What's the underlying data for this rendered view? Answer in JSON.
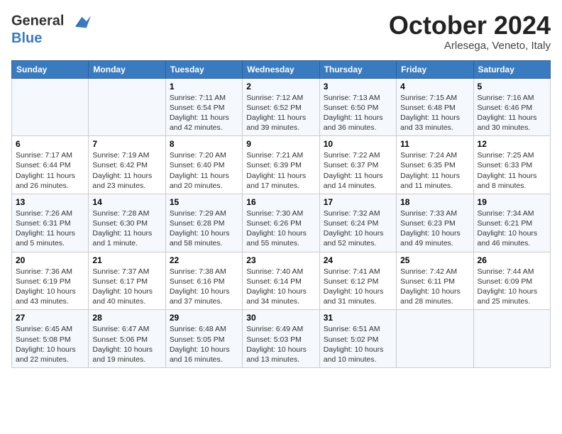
{
  "header": {
    "logo_line1": "General",
    "logo_line2": "Blue",
    "month": "October 2024",
    "location": "Arlesega, Veneto, Italy"
  },
  "weekdays": [
    "Sunday",
    "Monday",
    "Tuesday",
    "Wednesday",
    "Thursday",
    "Friday",
    "Saturday"
  ],
  "weeks": [
    [
      {
        "day": "",
        "detail": ""
      },
      {
        "day": "",
        "detail": ""
      },
      {
        "day": "1",
        "detail": "Sunrise: 7:11 AM\nSunset: 6:54 PM\nDaylight: 11 hours and 42 minutes."
      },
      {
        "day": "2",
        "detail": "Sunrise: 7:12 AM\nSunset: 6:52 PM\nDaylight: 11 hours and 39 minutes."
      },
      {
        "day": "3",
        "detail": "Sunrise: 7:13 AM\nSunset: 6:50 PM\nDaylight: 11 hours and 36 minutes."
      },
      {
        "day": "4",
        "detail": "Sunrise: 7:15 AM\nSunset: 6:48 PM\nDaylight: 11 hours and 33 minutes."
      },
      {
        "day": "5",
        "detail": "Sunrise: 7:16 AM\nSunset: 6:46 PM\nDaylight: 11 hours and 30 minutes."
      }
    ],
    [
      {
        "day": "6",
        "detail": "Sunrise: 7:17 AM\nSunset: 6:44 PM\nDaylight: 11 hours and 26 minutes."
      },
      {
        "day": "7",
        "detail": "Sunrise: 7:19 AM\nSunset: 6:42 PM\nDaylight: 11 hours and 23 minutes."
      },
      {
        "day": "8",
        "detail": "Sunrise: 7:20 AM\nSunset: 6:40 PM\nDaylight: 11 hours and 20 minutes."
      },
      {
        "day": "9",
        "detail": "Sunrise: 7:21 AM\nSunset: 6:39 PM\nDaylight: 11 hours and 17 minutes."
      },
      {
        "day": "10",
        "detail": "Sunrise: 7:22 AM\nSunset: 6:37 PM\nDaylight: 11 hours and 14 minutes."
      },
      {
        "day": "11",
        "detail": "Sunrise: 7:24 AM\nSunset: 6:35 PM\nDaylight: 11 hours and 11 minutes."
      },
      {
        "day": "12",
        "detail": "Sunrise: 7:25 AM\nSunset: 6:33 PM\nDaylight: 11 hours and 8 minutes."
      }
    ],
    [
      {
        "day": "13",
        "detail": "Sunrise: 7:26 AM\nSunset: 6:31 PM\nDaylight: 11 hours and 5 minutes."
      },
      {
        "day": "14",
        "detail": "Sunrise: 7:28 AM\nSunset: 6:30 PM\nDaylight: 11 hours and 1 minute."
      },
      {
        "day": "15",
        "detail": "Sunrise: 7:29 AM\nSunset: 6:28 PM\nDaylight: 10 hours and 58 minutes."
      },
      {
        "day": "16",
        "detail": "Sunrise: 7:30 AM\nSunset: 6:26 PM\nDaylight: 10 hours and 55 minutes."
      },
      {
        "day": "17",
        "detail": "Sunrise: 7:32 AM\nSunset: 6:24 PM\nDaylight: 10 hours and 52 minutes."
      },
      {
        "day": "18",
        "detail": "Sunrise: 7:33 AM\nSunset: 6:23 PM\nDaylight: 10 hours and 49 minutes."
      },
      {
        "day": "19",
        "detail": "Sunrise: 7:34 AM\nSunset: 6:21 PM\nDaylight: 10 hours and 46 minutes."
      }
    ],
    [
      {
        "day": "20",
        "detail": "Sunrise: 7:36 AM\nSunset: 6:19 PM\nDaylight: 10 hours and 43 minutes."
      },
      {
        "day": "21",
        "detail": "Sunrise: 7:37 AM\nSunset: 6:17 PM\nDaylight: 10 hours and 40 minutes."
      },
      {
        "day": "22",
        "detail": "Sunrise: 7:38 AM\nSunset: 6:16 PM\nDaylight: 10 hours and 37 minutes."
      },
      {
        "day": "23",
        "detail": "Sunrise: 7:40 AM\nSunset: 6:14 PM\nDaylight: 10 hours and 34 minutes."
      },
      {
        "day": "24",
        "detail": "Sunrise: 7:41 AM\nSunset: 6:12 PM\nDaylight: 10 hours and 31 minutes."
      },
      {
        "day": "25",
        "detail": "Sunrise: 7:42 AM\nSunset: 6:11 PM\nDaylight: 10 hours and 28 minutes."
      },
      {
        "day": "26",
        "detail": "Sunrise: 7:44 AM\nSunset: 6:09 PM\nDaylight: 10 hours and 25 minutes."
      }
    ],
    [
      {
        "day": "27",
        "detail": "Sunrise: 6:45 AM\nSunset: 5:08 PM\nDaylight: 10 hours and 22 minutes."
      },
      {
        "day": "28",
        "detail": "Sunrise: 6:47 AM\nSunset: 5:06 PM\nDaylight: 10 hours and 19 minutes."
      },
      {
        "day": "29",
        "detail": "Sunrise: 6:48 AM\nSunset: 5:05 PM\nDaylight: 10 hours and 16 minutes."
      },
      {
        "day": "30",
        "detail": "Sunrise: 6:49 AM\nSunset: 5:03 PM\nDaylight: 10 hours and 13 minutes."
      },
      {
        "day": "31",
        "detail": "Sunrise: 6:51 AM\nSunset: 5:02 PM\nDaylight: 10 hours and 10 minutes."
      },
      {
        "day": "",
        "detail": ""
      },
      {
        "day": "",
        "detail": ""
      }
    ]
  ]
}
